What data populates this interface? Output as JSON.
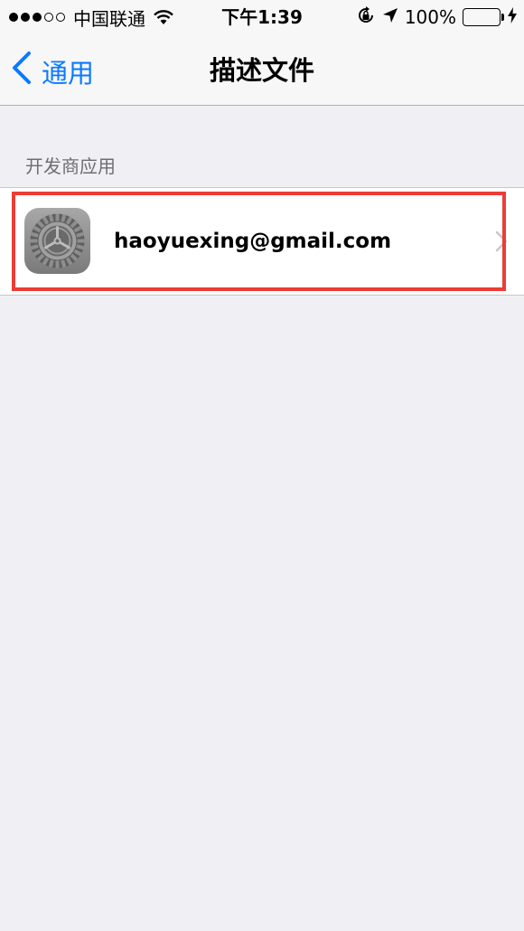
{
  "status_bar": {
    "signal_dots_full": 3,
    "signal_dots_total": 5,
    "carrier": "中国联通",
    "time": "下午1:39",
    "battery_percent": "100%",
    "battery_color": "#4cd964",
    "icons": [
      "wifi-icon",
      "rotation-lock-icon",
      "location-arrow-icon",
      "battery-icon",
      "charging-bolt-icon"
    ]
  },
  "navbar": {
    "back_label": "通用",
    "title": "描述文件",
    "accent_color": "#0a7aff"
  },
  "section": {
    "header": "开发商应用",
    "items": [
      {
        "label": "haoyuexing@gmail.com",
        "icon": "settings-gear-icon"
      }
    ]
  },
  "highlight_color": "#ea3d36"
}
